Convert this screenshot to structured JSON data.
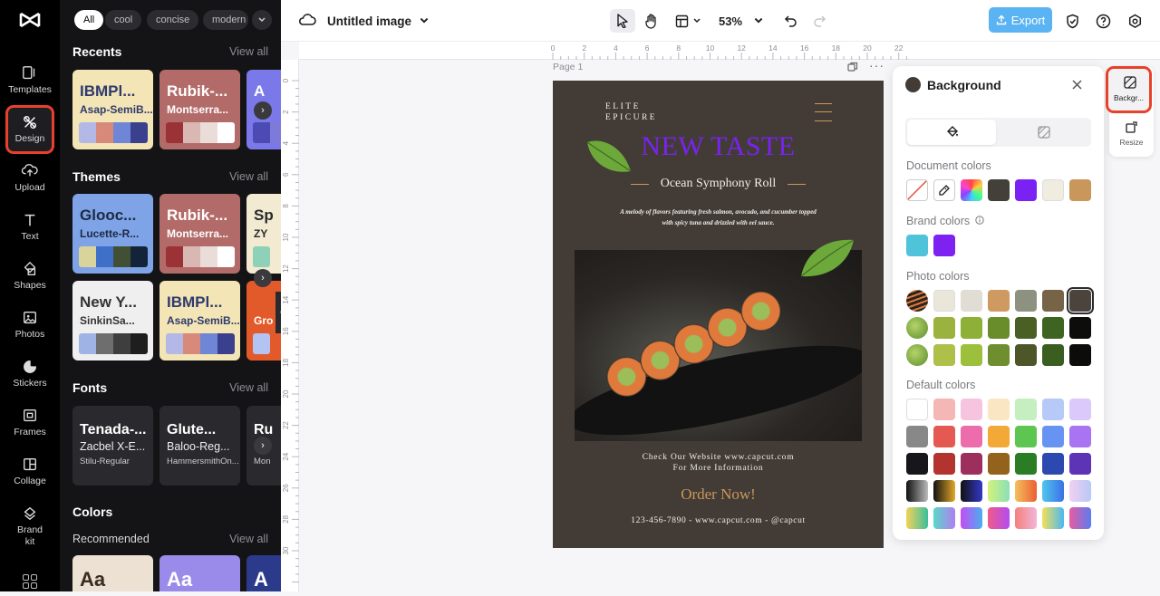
{
  "rail": {
    "items": [
      {
        "label": "Templates",
        "icon": "templates-icon"
      },
      {
        "label": "Design",
        "icon": "design-icon"
      },
      {
        "label": "Upload",
        "icon": "upload-icon"
      },
      {
        "label": "Text",
        "icon": "text-icon"
      },
      {
        "label": "Shapes",
        "icon": "shapes-icon"
      },
      {
        "label": "Photos",
        "icon": "photos-icon"
      },
      {
        "label": "Stickers",
        "icon": "stickers-icon"
      },
      {
        "label": "Frames",
        "icon": "frames-icon"
      },
      {
        "label": "Collage",
        "icon": "collage-icon"
      },
      {
        "label": "Brand\nkit",
        "icon": "brand-kit-icon"
      }
    ]
  },
  "panel": {
    "chips": [
      "All",
      "cool",
      "concise",
      "modern"
    ],
    "view_all": "View all",
    "recents": {
      "title": "Recents",
      "cards": [
        {
          "t1": "IBMPl...",
          "t2": "Asap-SemiB...",
          "bg": "#f3e5b5",
          "fg": "#2f3a6e",
          "sw": [
            "#b4b8e6",
            "#d88a7a",
            "#6f86d6",
            "#3a3f8e"
          ]
        },
        {
          "t1": "Rubik-...",
          "t2": "Montserra...",
          "bg": "#b26b69",
          "fg": "#ffffff",
          "sw": [
            "#9b3236",
            "#d9b8b4",
            "#e9dcd9",
            "#ffffff"
          ]
        },
        {
          "t1": "A",
          "t2": "",
          "bg": "#7b78ea",
          "fg": "#ffffff",
          "sw": [
            "#4b4bb3",
            "#7e7ad9"
          ]
        }
      ]
    },
    "themes": {
      "title": "Themes",
      "cards": [
        {
          "t1": "Glooc...",
          "t2": "Lucette-R...",
          "bg": "#7ea3e6",
          "fg": "#1e2a44",
          "sw": [
            "#d8d49b",
            "#3e70c9",
            "#415034",
            "#13233a"
          ]
        },
        {
          "t1": "Rubik-...",
          "t2": "Montserra...",
          "bg": "#b26b69",
          "fg": "#ffffff",
          "sw": [
            "#9b3236",
            "#d9b8b4",
            "#e9dcd9",
            "#ffffff"
          ]
        },
        {
          "t1": "Sp",
          "t2": "ZY",
          "bg": "#f3ead2",
          "fg": "#2a2a2a",
          "sw": [
            "#8fd0b8"
          ]
        },
        {
          "t1": "New Y...",
          "t2": "SinkinSa...",
          "bg": "#efefef",
          "fg": "#333333",
          "sw": [
            "#9fb3e4",
            "#6e6e6e",
            "#3e3e3e",
            "#1e1e1e"
          ]
        },
        {
          "t1": "IBMPl...",
          "t2": "Asap-SemiB...",
          "bg": "#f3e5b5",
          "fg": "#2f3a6e",
          "sw": [
            "#b4b8e6",
            "#d88a7a",
            "#6f86d6",
            "#3a3f8e"
          ]
        },
        {
          "t1": "",
          "t2": "Gro",
          "bg": "#e35a2a",
          "fg": "#ffffff",
          "sw": [
            "#b4c4f2"
          ]
        }
      ]
    },
    "fonts": {
      "title": "Fonts",
      "cards": [
        {
          "a": "Tenada-...",
          "b": "Zacbel X-E...",
          "c": "Stilu-Regular"
        },
        {
          "a": "Glute...",
          "b": "Baloo-Reg...",
          "c": "HammersmithOn..."
        },
        {
          "a": "Ru",
          "b": "",
          "c": "Mon"
        }
      ]
    },
    "colors": {
      "title": "Colors",
      "subtitle": "Recommended",
      "cards": [
        {
          "t": "Aa",
          "bg": "#ece1d3",
          "fg": "#3a2b1f"
        },
        {
          "t": "Aa",
          "bg": "#9a8bea",
          "fg": "#ffffff"
        },
        {
          "t": "A",
          "bg": "#2c3a8c",
          "fg": "#ffffff"
        }
      ]
    }
  },
  "topbar": {
    "doc_title": "Untitled image",
    "zoom": "53%",
    "export_label": "Export"
  },
  "ruler": {
    "top_ticks": [
      "0",
      "2",
      "4",
      "6",
      "8",
      "10",
      "12",
      "14",
      "16",
      "18",
      "20",
      "22"
    ],
    "left_ticks": [
      "0",
      "2",
      "4",
      "6",
      "8",
      "10",
      "12",
      "14",
      "16",
      "18",
      "20",
      "22",
      "24",
      "26",
      "28",
      "30"
    ]
  },
  "page": {
    "label": "Page 1"
  },
  "poster": {
    "brand_line1": "ELITE",
    "brand_line2": "EPICURE",
    "headline": "NEW TASTE",
    "subtitle": "Ocean Symphony Roll",
    "description": "A melody of flavors featuring fresh salmon, avocado, and cucumber topped with spicy tuna and drizzled with eel sauce.",
    "website_line1": "Check Our Website www.capcut.com",
    "website_line2": "For More Information",
    "cta": "Order Now!",
    "contact": "123-456-7890 - www.capcut.com - @capcut"
  },
  "background_panel": {
    "title": "Background",
    "document_colors_label": "Document colors",
    "document_colors": [
      "#434039",
      "#7a22f3",
      "#f0ece0",
      "#c9965b"
    ],
    "brand_colors_label": "Brand colors",
    "brand_colors": [
      "#4fc3da",
      "#7d22f0"
    ],
    "photo_colors_label": "Photo colors",
    "photo_colors": [
      [
        "#ebe6da",
        "#e2ddd4",
        "#cf9a62",
        "#8d9180",
        "#776346",
        "#4a443c"
      ],
      [
        "#9bb33e",
        "#8fb036",
        "#6a8d2c",
        "#4a5f24",
        "#3e6421",
        "#0d0d0b"
      ],
      [
        "#aebf4a",
        "#9cbf3c",
        "#6e8e2f",
        "#4d5628",
        "#3a5e20",
        "#0c0d0a"
      ]
    ],
    "default_colors_label": "Default colors",
    "default_colors": [
      [
        "#ffffff",
        "#f5b7b5",
        "#f6c4df",
        "#fbe6c4",
        "#c5efc1",
        "#b7c9f7",
        "#dbc9fb"
      ],
      [
        "#888888",
        "#e45a52",
        "#ec6cac",
        "#f2a937",
        "#5cc651",
        "#6794f2",
        "#a874f2"
      ],
      [
        "#17171b",
        "#b3342e",
        "#9c2f5e",
        "#93621c",
        "#2b7d25",
        "#2c49b0",
        "#5c34b5"
      ]
    ],
    "gradient_rows": [
      [
        "linear-gradient(90deg,#111,#bbb)",
        "linear-gradient(90deg,#111,#e4a82a)",
        "linear-gradient(90deg,#111,#3338c8)",
        "linear-gradient(90deg,#d4f27a,#88e0b8)",
        "linear-gradient(90deg,#f3c15c,#ec5e34)",
        "linear-gradient(90deg,#4fc7ec,#3b70e8)",
        "linear-gradient(90deg,#f2d0f2,#b7c9f7)"
      ],
      [
        "linear-gradient(90deg,#f2d35a,#3cbf9a)",
        "linear-gradient(90deg,#57d8c8,#b27ef2)",
        "linear-gradient(90deg,#c54cf2,#4baef2)",
        "linear-gradient(90deg,#f05a8a,#b44cf2)",
        "linear-gradient(90deg,#f4807c,#f2b5d8)",
        "linear-gradient(90deg,#f2e05a,#4ab8f2)",
        "linear-gradient(90deg,#e85ca0,#5a7cf2)"
      ]
    ]
  },
  "side_tools": {
    "background_label": "Backgr...",
    "resize_label": "Resize"
  },
  "colors": {
    "highlight": "#e8412b",
    "accent_purple": "#7a22f3",
    "export_blue": "#5ab3f2",
    "poster_bg": "#433c36",
    "gold": "#c9965b"
  }
}
